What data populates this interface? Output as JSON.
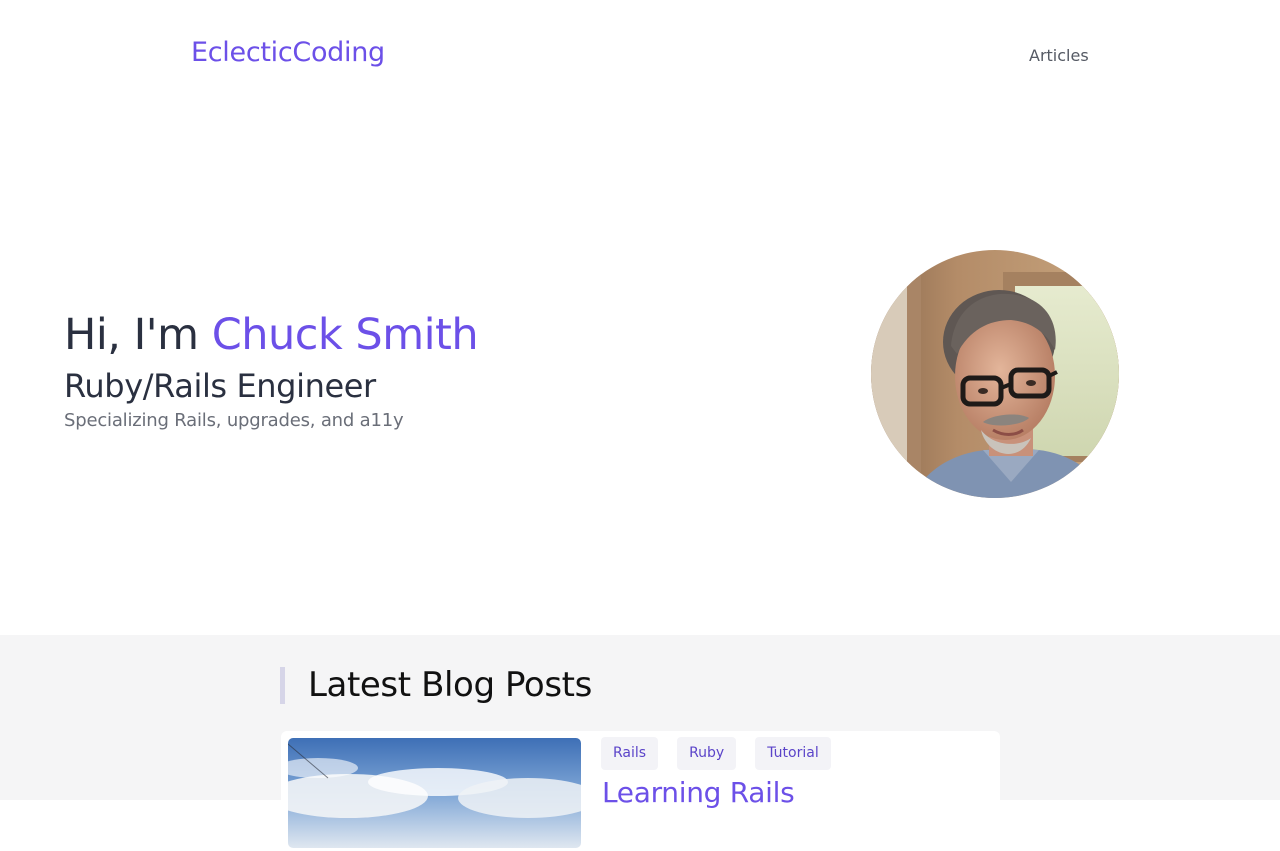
{
  "header": {
    "brand": "EclecticCoding",
    "nav": [
      {
        "label": "Articles"
      }
    ]
  },
  "hero": {
    "greeting_prefix": "Hi, I'm",
    "name": "Chuck Smith",
    "role": "Ruby/Rails Engineer",
    "tagline": "Specializing Rails, upgrades, and a11y"
  },
  "blog": {
    "section_title": "Latest Blog Posts",
    "posts": [
      {
        "tags": [
          "Rails",
          "Ruby",
          "Tutorial"
        ],
        "title": "Learning Rails"
      }
    ]
  },
  "colors": {
    "accent": "#6c50e8",
    "text_dark": "#2a3040",
    "text_muted": "#6a6e78",
    "section_bg": "#f5f5f6",
    "tag_bg": "#f3f3f7"
  }
}
